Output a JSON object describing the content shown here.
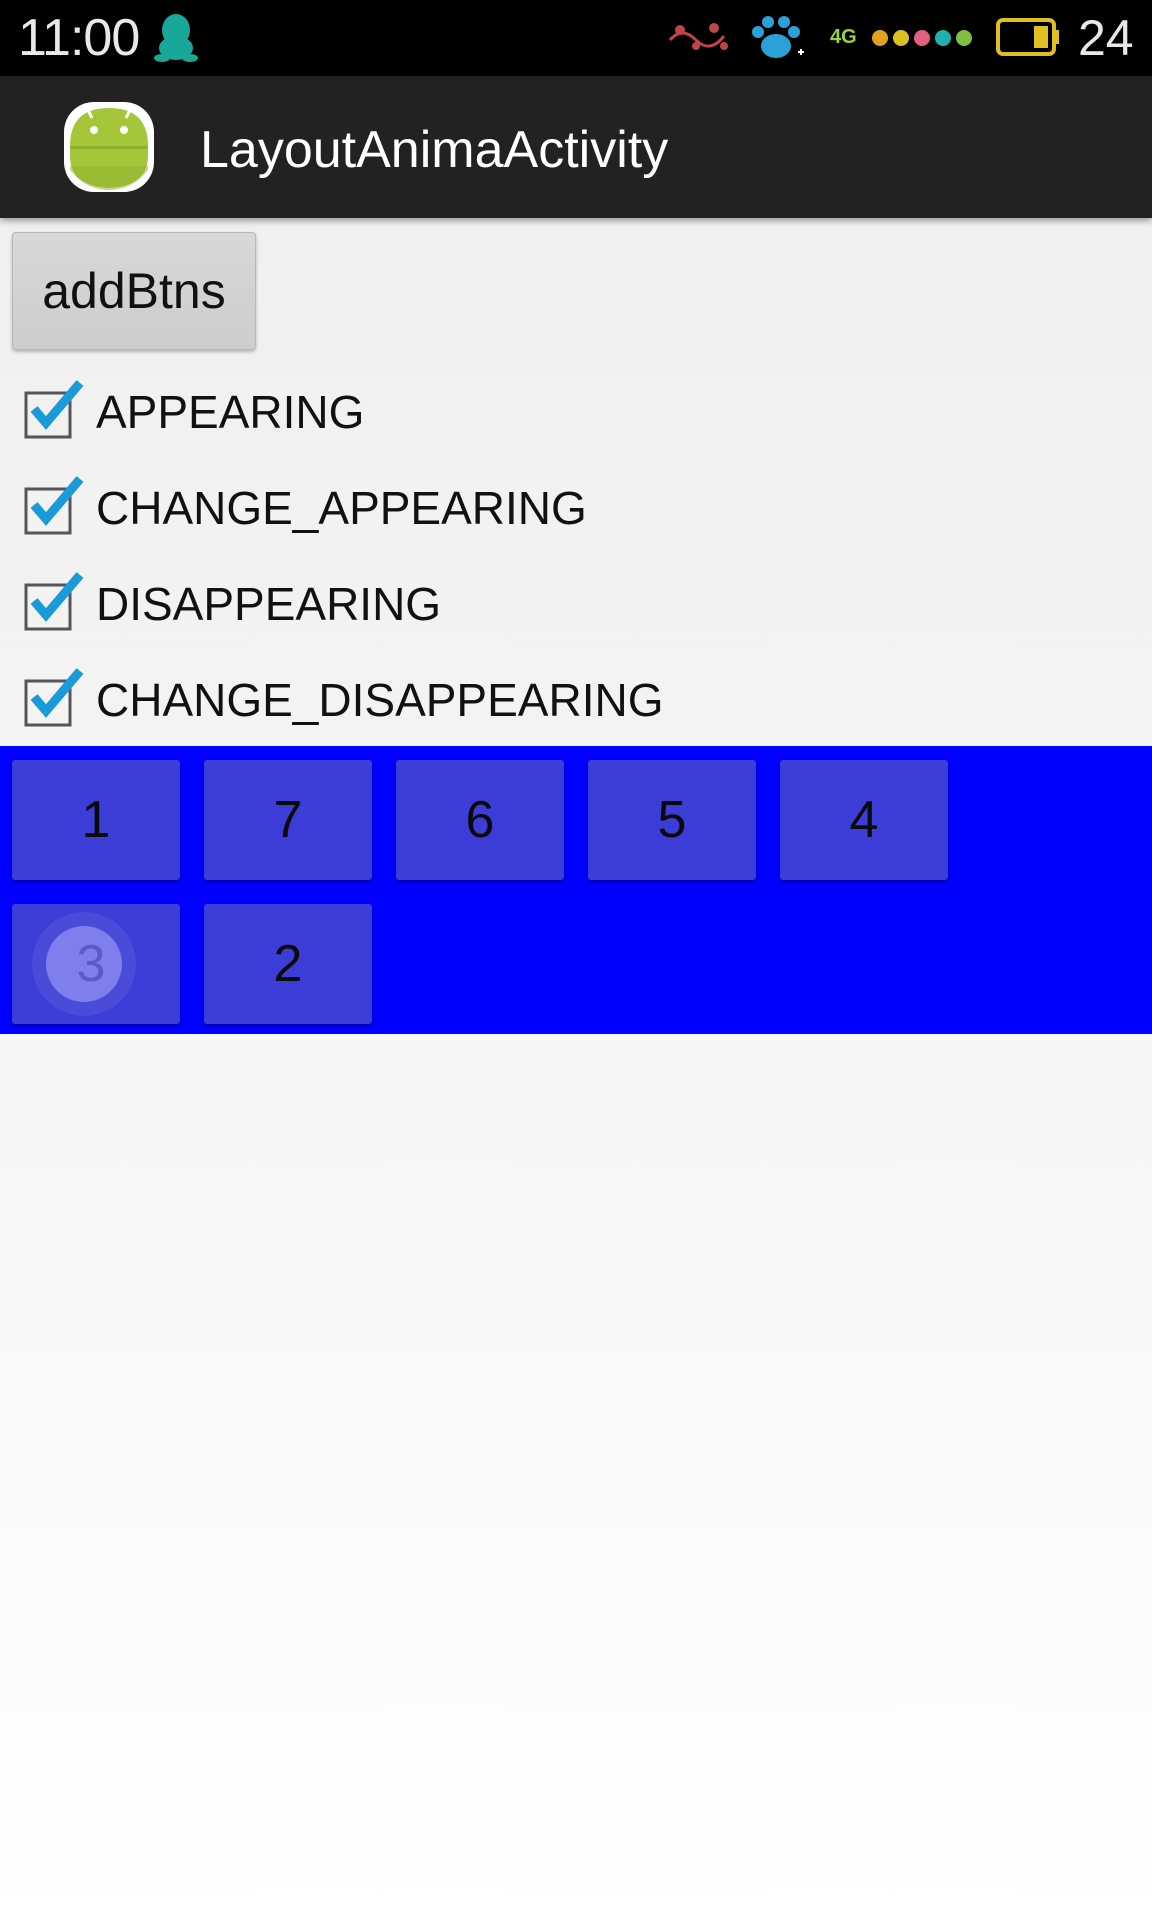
{
  "status_bar": {
    "time": "11:00",
    "network": "4G",
    "battery_level": "24",
    "icons": [
      "qq-icon",
      "flower-icon",
      "paw-icon",
      "signal-dots-icon",
      "battery-icon"
    ]
  },
  "action_bar": {
    "title": "LayoutAnimaActivity",
    "icon": "android-app-icon"
  },
  "add_button": {
    "label": "addBtns"
  },
  "checkboxes": [
    {
      "label": "APPEARING",
      "checked": true
    },
    {
      "label": "CHANGE_APPEARING",
      "checked": true
    },
    {
      "label": "DISAPPEARING",
      "checked": true
    },
    {
      "label": "CHANGE_DISAPPEARING",
      "checked": true
    }
  ],
  "grid_buttons": [
    {
      "label": "1"
    },
    {
      "label": "7"
    },
    {
      "label": "6"
    },
    {
      "label": "5"
    },
    {
      "label": "4"
    },
    {
      "label": "3",
      "pressed": true
    },
    {
      "label": "2"
    }
  ],
  "colors": {
    "grid_background": "#0000ff",
    "grid_button": "#3c3cd6",
    "checkbox_tick": "#1a9ad6",
    "action_bar": "#222222",
    "status_bar": "#000000"
  }
}
